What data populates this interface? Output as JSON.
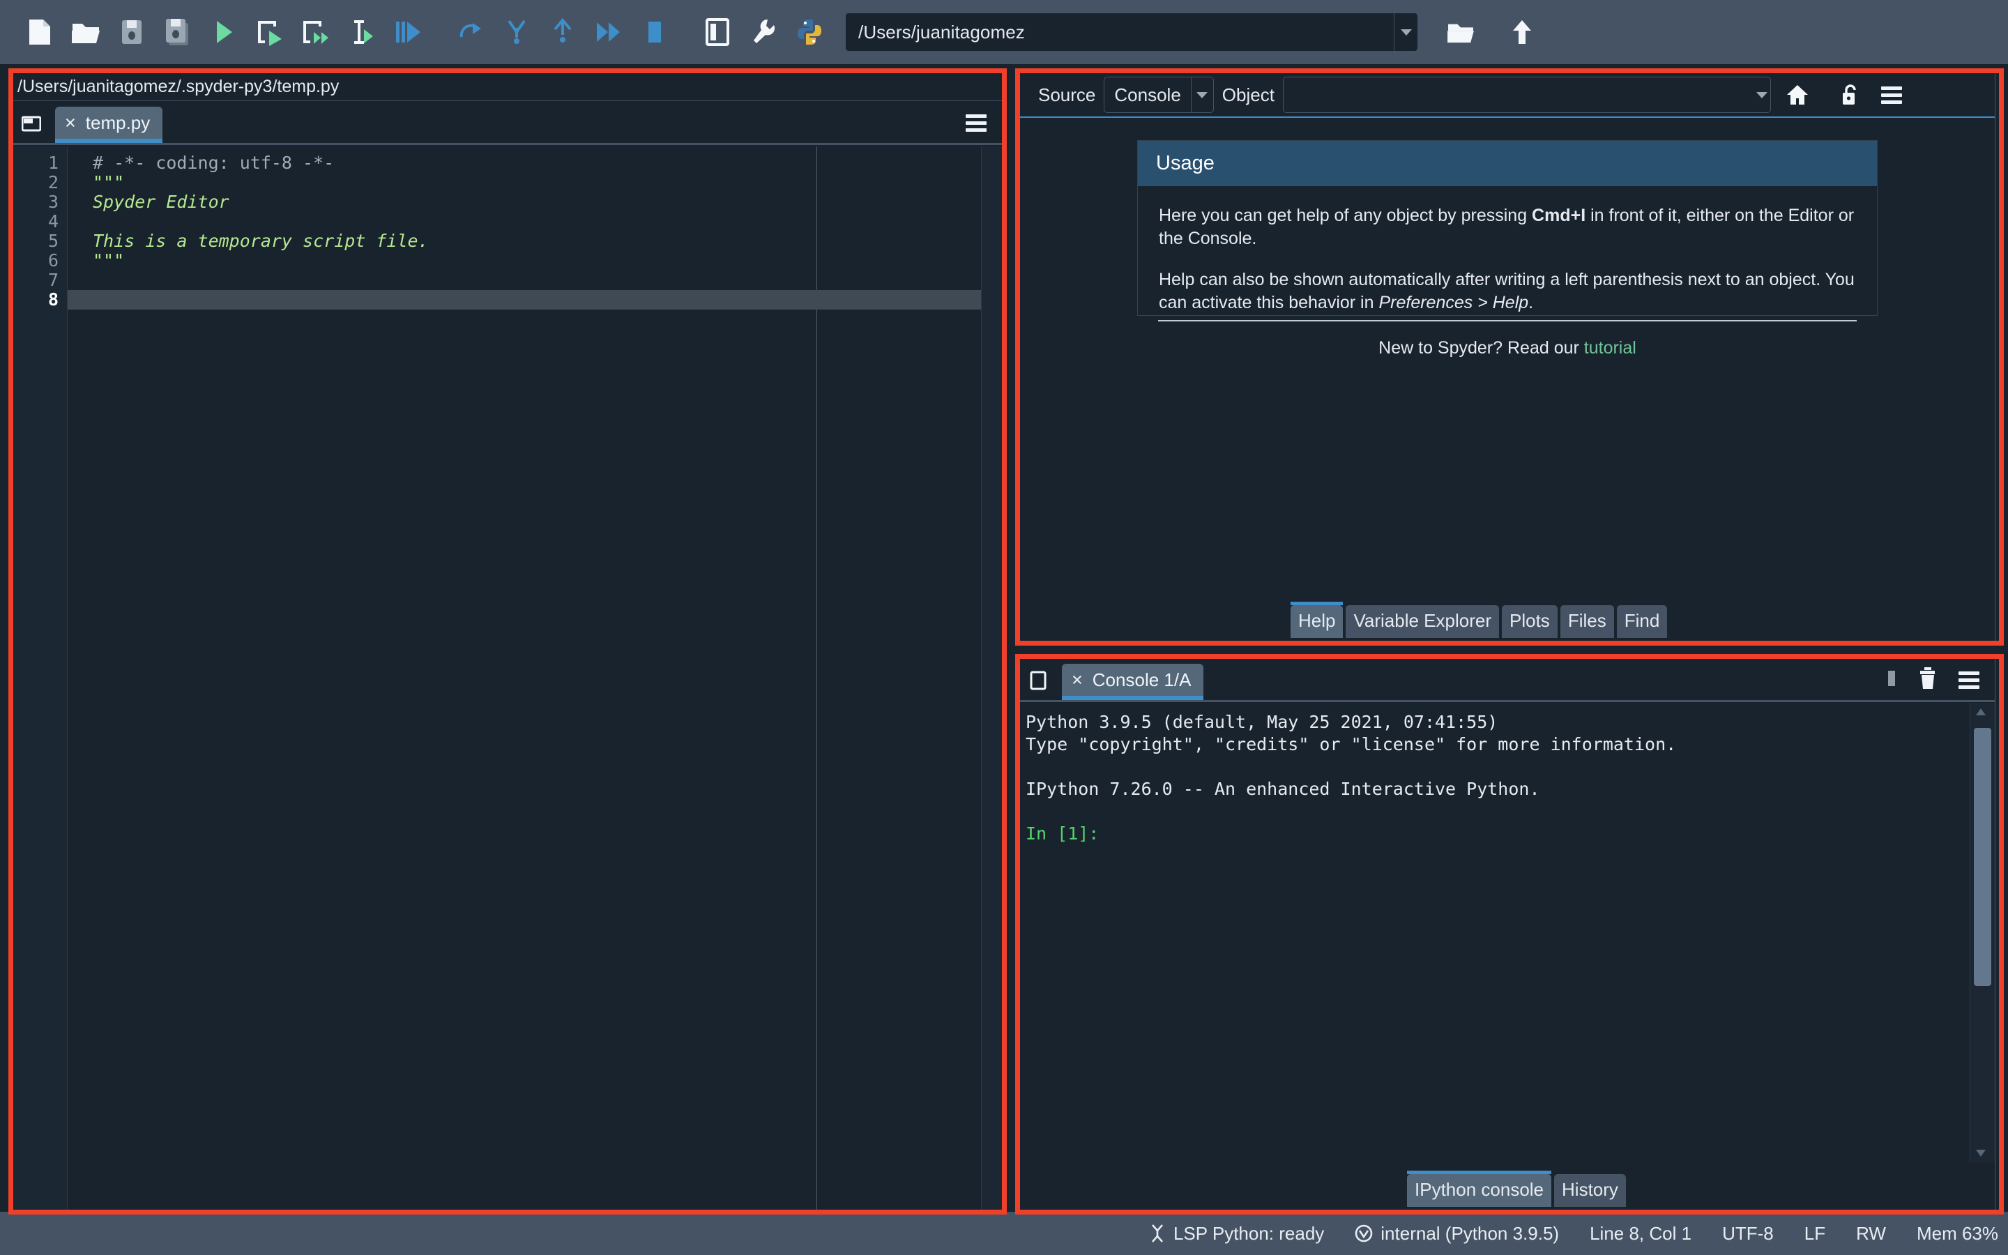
{
  "app": {
    "name": "Spyder",
    "accent_blue": "#3d8ec9",
    "toolbar_bg": "#455364",
    "pane_bg": "#19232d",
    "annotation_color": "#f0402a"
  },
  "toolbar": {
    "buttons": [
      {
        "name": "new-file-icon",
        "tip": "New file"
      },
      {
        "name": "open-file-icon",
        "tip": "Open file"
      },
      {
        "name": "save-file-icon",
        "tip": "Save file"
      },
      {
        "name": "save-all-icon",
        "tip": "Save all"
      },
      {
        "name": "run-file-icon",
        "tip": "Run file"
      },
      {
        "name": "run-cell-icon",
        "tip": "Run current cell"
      },
      {
        "name": "run-cell-advance-icon",
        "tip": "Run current cell and go to the next one"
      },
      {
        "name": "run-selection-icon",
        "tip": "Run selection or current line"
      },
      {
        "name": "debug-file-icon",
        "tip": "Debug file"
      },
      {
        "name": "step-over-icon",
        "tip": "Run current line"
      },
      {
        "name": "step-into-icon",
        "tip": "Step into function"
      },
      {
        "name": "step-return-icon",
        "tip": "Run until function returns"
      },
      {
        "name": "continue-icon",
        "tip": "Continue execution"
      },
      {
        "name": "stop-debug-icon",
        "tip": "Stop debugging"
      },
      {
        "name": "maximize-pane-icon",
        "tip": "Maximize current pane"
      },
      {
        "name": "preferences-icon",
        "tip": "Preferences"
      },
      {
        "name": "pythonpath-manager-icon",
        "tip": "PYTHONPATH manager"
      }
    ],
    "cwd": {
      "value": "/Users/juanitagomez",
      "placeholder": "Current working directory"
    },
    "browse_label": "browse-directory-icon",
    "parent_label": "parent-directory-icon"
  },
  "editor": {
    "file_path": "/Users/juanitagomez/.spyder-py3/temp.py",
    "tab": {
      "label": "temp.py",
      "close": "×"
    },
    "options_label": "options-menu-icon",
    "browse_tabs_label": "browse-tabs-icon",
    "lines": [
      {
        "num": "1",
        "text": "# -*- coding: utf-8 -*-",
        "style": "comment"
      },
      {
        "num": "2",
        "text": "\"\"\"",
        "style": "string"
      },
      {
        "num": "3",
        "text": "Spyder Editor",
        "style": "string"
      },
      {
        "num": "4",
        "text": "",
        "style": "string"
      },
      {
        "num": "5",
        "text": "This is a temporary script file.",
        "style": "string"
      },
      {
        "num": "6",
        "text": "\"\"\"",
        "style": "string"
      },
      {
        "num": "7",
        "text": "",
        "style": "plain"
      },
      {
        "num": "8",
        "text": "",
        "style": "plain"
      }
    ],
    "current_line": 8
  },
  "help": {
    "source_label": "Source",
    "source_value": "Console",
    "object_label": "Object",
    "object_value": "",
    "object_placeholder": "",
    "home_label": "home-icon",
    "lock_label": "lock-icon",
    "options_label": "options-menu-icon",
    "usage": {
      "title": "Usage",
      "paragraph1_pre": "Here you can get help of any object by pressing ",
      "paragraph1_kbd": "Cmd+I",
      "paragraph1_post": " in front of it, either on the Editor or the Console.",
      "paragraph2_pre": "Help can also be shown automatically after writing a left parenthesis next to an object. You can activate this behavior in ",
      "paragraph2_em": "Preferences > Help",
      "paragraph2_post": ".",
      "footer_pre": "New to Spyder? Read our ",
      "footer_link": "tutorial"
    },
    "dock_tabs": [
      {
        "label": "Help",
        "active": true
      },
      {
        "label": "Variable Explorer",
        "active": false
      },
      {
        "label": "Plots",
        "active": false
      },
      {
        "label": "Files",
        "active": false
      },
      {
        "label": "Find",
        "active": false
      }
    ]
  },
  "console": {
    "tab": {
      "label": "Console 1/A",
      "close": "×"
    },
    "browse_tabs_label": "browse-tabs-icon",
    "interrupt_label": "interrupt-kernel-icon",
    "remove_label": "remove-all-variables-icon",
    "options_label": "options-menu-icon",
    "output": [
      {
        "text": "Python 3.9.5 (default, May 25 2021, 07:41:55)",
        "style": "plain"
      },
      {
        "text": "Type \"copyright\", \"credits\" or \"license\" for more information.",
        "style": "plain"
      },
      {
        "text": "",
        "style": "plain"
      },
      {
        "text": "IPython 7.26.0 -- An enhanced Interactive Python.",
        "style": "plain"
      },
      {
        "text": "",
        "style": "plain"
      },
      {
        "text": "In [1]:",
        "style": "prompt"
      }
    ],
    "dock_tabs": [
      {
        "label": "IPython console",
        "active": true
      },
      {
        "label": "History",
        "active": false
      }
    ]
  },
  "status_bar": {
    "lsp": "LSP Python: ready",
    "interpreter": "internal (Python 3.9.5)",
    "cursor": "Line 8, Col 1",
    "encoding": "UTF-8",
    "eol": "LF",
    "permissions": "RW",
    "memory": "Mem 63%"
  }
}
